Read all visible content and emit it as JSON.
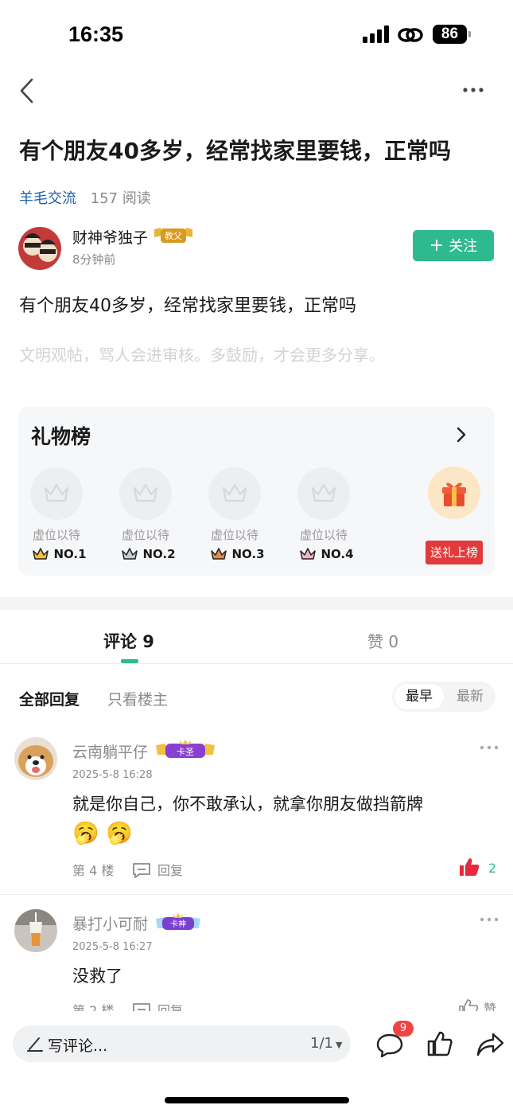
{
  "status": {
    "time": "16:35",
    "battery": "86"
  },
  "post": {
    "title": "有个朋友40多岁，经常找家里要钱，正常吗",
    "channel": "羊毛交流",
    "reads": "157 阅读",
    "author": "财神爷独子",
    "author_badge": "教父",
    "time": "8分钟前",
    "follow_label": "关注",
    "body": "有个朋友40多岁，经常找家里要钱，正常吗",
    "hint": "文明观帖，骂人会进审核。多鼓励，才会更多分享。"
  },
  "gift": {
    "title": "礼物榜",
    "slots": [
      {
        "waiting": "虚位以待",
        "rank": "NO.1"
      },
      {
        "waiting": "虚位以待",
        "rank": "NO.2"
      },
      {
        "waiting": "虚位以待",
        "rank": "NO.3"
      },
      {
        "waiting": "虚位以待",
        "rank": "NO.4"
      }
    ],
    "send_label": "送礼上榜"
  },
  "tabs": {
    "comments": "评论 9",
    "likes": "赞 0"
  },
  "filters": {
    "all": "全部回复",
    "op_only": "只看楼主",
    "earliest": "最早",
    "latest": "最新"
  },
  "comments": [
    {
      "name": "云南躺平仔",
      "badge": "卡圣",
      "date": "2025-5-8 16:28",
      "text": "就是你自己，你不敢承认，就拿你朋友做挡箭牌",
      "emojis": "🥱 🥱",
      "floor": "第 4 楼",
      "reply": "回复",
      "likes": "2"
    },
    {
      "name": "暴打小可耐",
      "badge": "卡神",
      "date": "2025-5-8 16:27",
      "text": "没救了",
      "floor": "第 2 楼",
      "reply": "回复",
      "likes": "赞"
    }
  ],
  "bottom": {
    "placeholder": "写评论...",
    "pager": "1/1",
    "comment_count": "9"
  },
  "colors": {
    "accent": "#2fb98e",
    "link": "#1f5fa8",
    "gift_red": "#e23a3a"
  }
}
